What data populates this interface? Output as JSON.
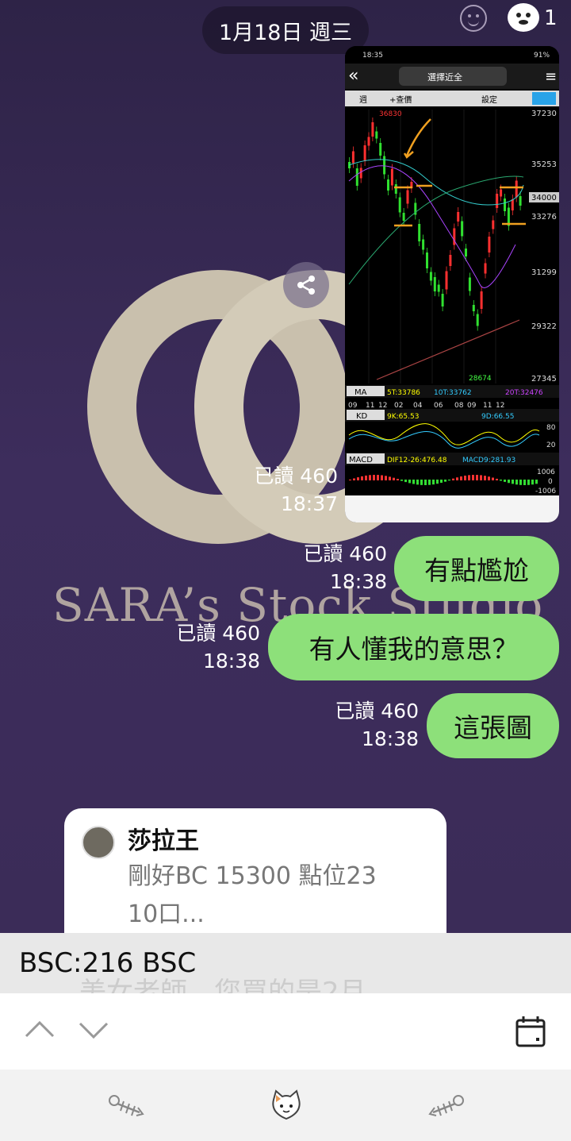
{
  "header": {
    "date": "1月18日 週三",
    "badge_count": "1"
  },
  "logo": {
    "text": "SARA’s Stock Studio"
  },
  "screenshot": {
    "status_time": "18:35",
    "status_right": "91%",
    "title": "選擇近全",
    "buttons": {
      "week": "週",
      "add": "+查價",
      "settings": "設定"
    },
    "price_ticks": [
      "37230",
      "35253",
      "34000",
      "33276",
      "31299",
      "29322",
      "27345"
    ],
    "high_label": "36830",
    "low_label": "28674",
    "ma_row": {
      "label": "MA",
      "v1": "5T:33786",
      "v2": "10T:33762",
      "v3": "20T:32476"
    },
    "x_ticks": [
      "09",
      "11",
      "12",
      "02",
      "04",
      "06",
      "08",
      "09",
      "11",
      "12"
    ],
    "kd_row": {
      "label": "KD",
      "v1": "9K:65.53",
      "v2": "9D:66.55",
      "t1": "80",
      "t2": "20"
    },
    "macd_row": {
      "label": "MACD",
      "v1": "DIF12-26:476.48",
      "v2": "MACD9:281.93",
      "t1": "1006",
      "t2": "0",
      "t3": "-1006"
    }
  },
  "messages": [
    {
      "read": "已讀 460",
      "time": "18:37"
    },
    {
      "read": "已讀 460",
      "time": "18:38",
      "text": "有點尷尬"
    },
    {
      "read": "已讀 460",
      "time": "18:38",
      "text": "有人懂我的意思？"
    },
    {
      "read": "已讀 460",
      "time": "18:38",
      "text": "這張圖"
    }
  ],
  "reply": {
    "name": "莎拉王",
    "text": "剛好BC 15300  點位23\n10口..."
  },
  "search": {
    "text": "BSC:216 BSC",
    "ghost": "美女老師，您買的是2月"
  },
  "colors": {
    "bubble": "#8de07a",
    "bg": "#3a2c55"
  }
}
